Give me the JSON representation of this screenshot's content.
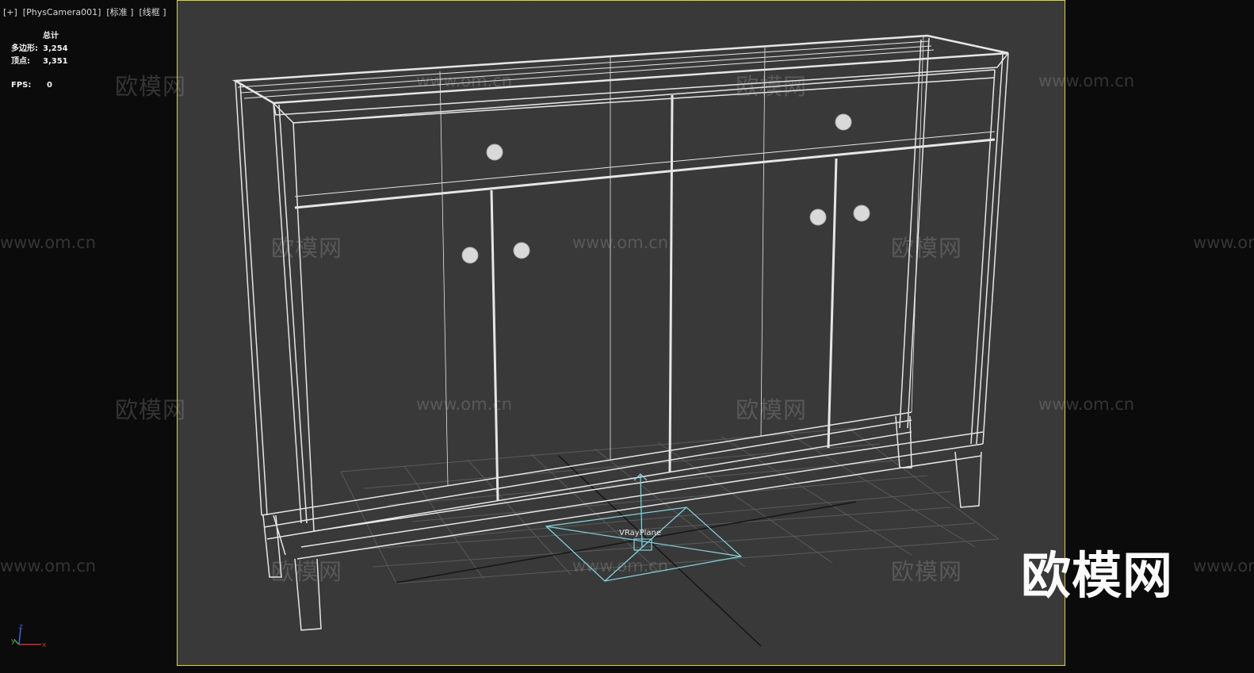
{
  "viewport": {
    "label": "[+]  [PhysCamera001]  [标准 ]  [线框 ]"
  },
  "stats": {
    "header": "总计",
    "polygons_label": "多边形:",
    "polygons_value": "3,254",
    "vertices_label": "顶点:",
    "vertices_value": "3,351",
    "fps_label": "FPS:",
    "fps_value": "0"
  },
  "scene": {
    "object_label": "VRayPlane"
  },
  "axis": {
    "x": "x",
    "y": "y",
    "z": "z"
  },
  "watermark": {
    "cn": "欧模网",
    "url": "www.om.cn"
  },
  "logo": {
    "text": "欧模网"
  },
  "colors": {
    "frame": "#d8d247",
    "viewport_bg": "#393939",
    "wireframe": "#e6e6e6",
    "vrayplane": "#7fd6e0"
  }
}
